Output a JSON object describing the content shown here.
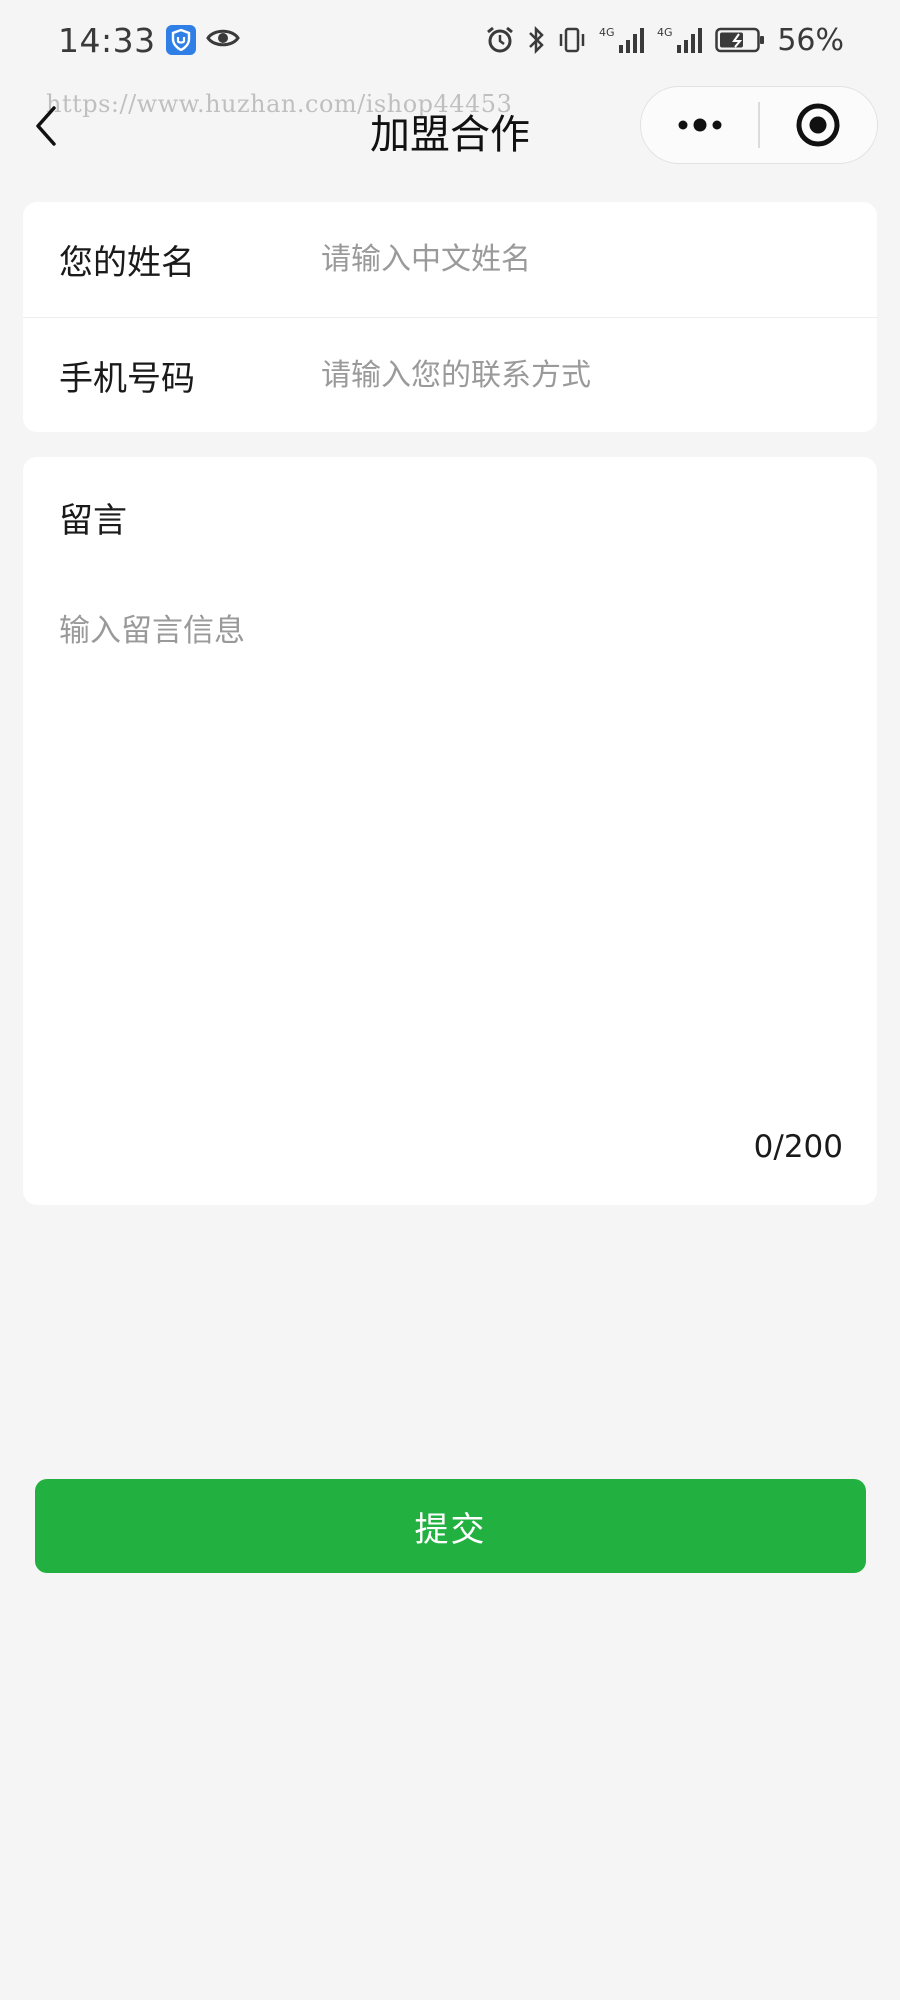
{
  "status_bar": {
    "time": "14:33",
    "battery": "56%",
    "network_1": "4G",
    "network_2": "4G"
  },
  "header": {
    "title": "加盟合作",
    "watermark": "https://www.huzhan.com/ishop44453"
  },
  "form": {
    "name_label": "您的姓名",
    "name_placeholder": "请输入中文姓名",
    "name_value": "",
    "phone_label": "手机号码",
    "phone_placeholder": "请输入您的联系方式",
    "phone_value": ""
  },
  "message": {
    "label": "留言",
    "placeholder": "输入留言信息",
    "value": "",
    "char_count": "0/200"
  },
  "submit_label": "提交",
  "colors": {
    "accent": "#22b140",
    "background": "#f5f5f5",
    "card": "#ffffff",
    "placeholder": "#9a9a9a"
  },
  "icons": [
    "back-icon",
    "more-icon",
    "close-target-icon",
    "shield-app-icon",
    "eye-icon",
    "alarm-icon",
    "bluetooth-icon",
    "vibrate-icon",
    "signal-icon",
    "battery-icon"
  ]
}
